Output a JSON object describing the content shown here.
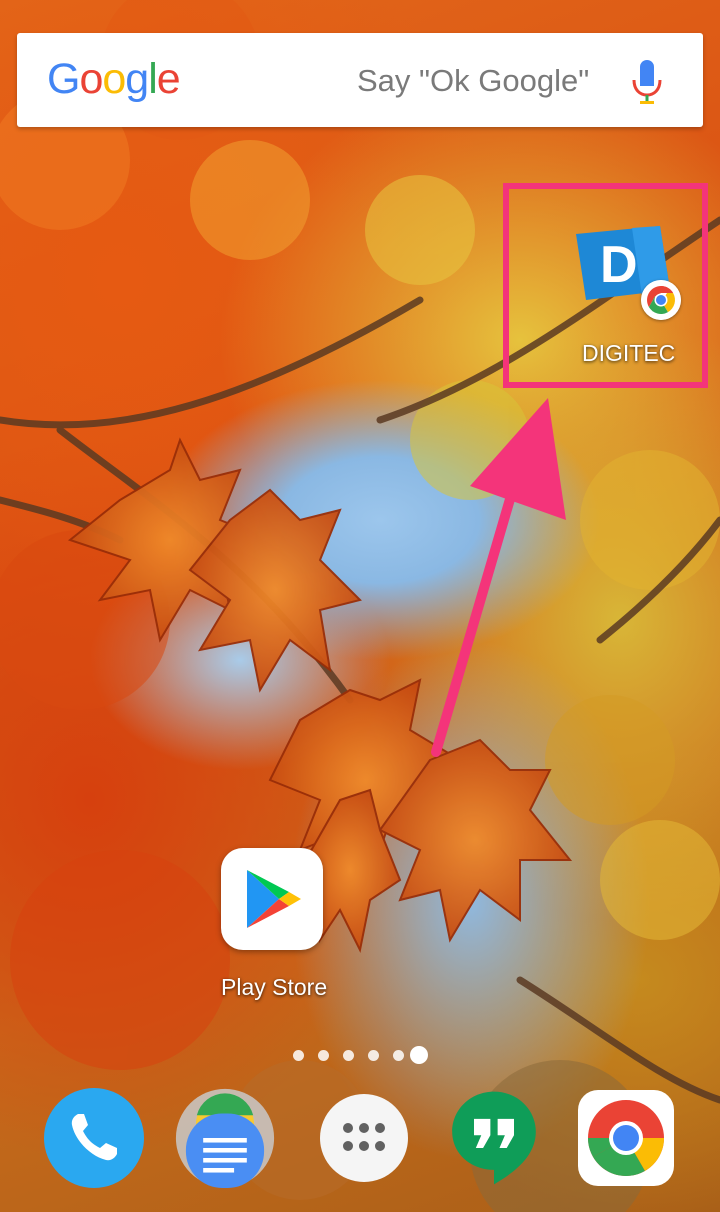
{
  "search_bar": {
    "logo_letters": [
      "G",
      "o",
      "o",
      "g",
      "l",
      "e"
    ],
    "logo_colors": [
      "#4285F4",
      "#EA4335",
      "#FBBC05",
      "#4285F4",
      "#34A853",
      "#EA4335"
    ],
    "hint": "Say \"Ok Google\""
  },
  "home_icons": {
    "digitec": {
      "label": "DIGITEC",
      "tile_letter": "D"
    },
    "play_store": {
      "label": "Play Store"
    }
  },
  "annotation": {
    "box_color": "#f4347a",
    "arrow_color": "#f4347a"
  },
  "page_indicator": {
    "page_count": 6,
    "active_page": 6
  },
  "dock": {
    "items": [
      {
        "name": "phone-icon"
      },
      {
        "name": "messages-folder-icon"
      },
      {
        "name": "app-drawer-icon"
      },
      {
        "name": "hangouts-icon"
      },
      {
        "name": "chrome-icon"
      }
    ]
  }
}
